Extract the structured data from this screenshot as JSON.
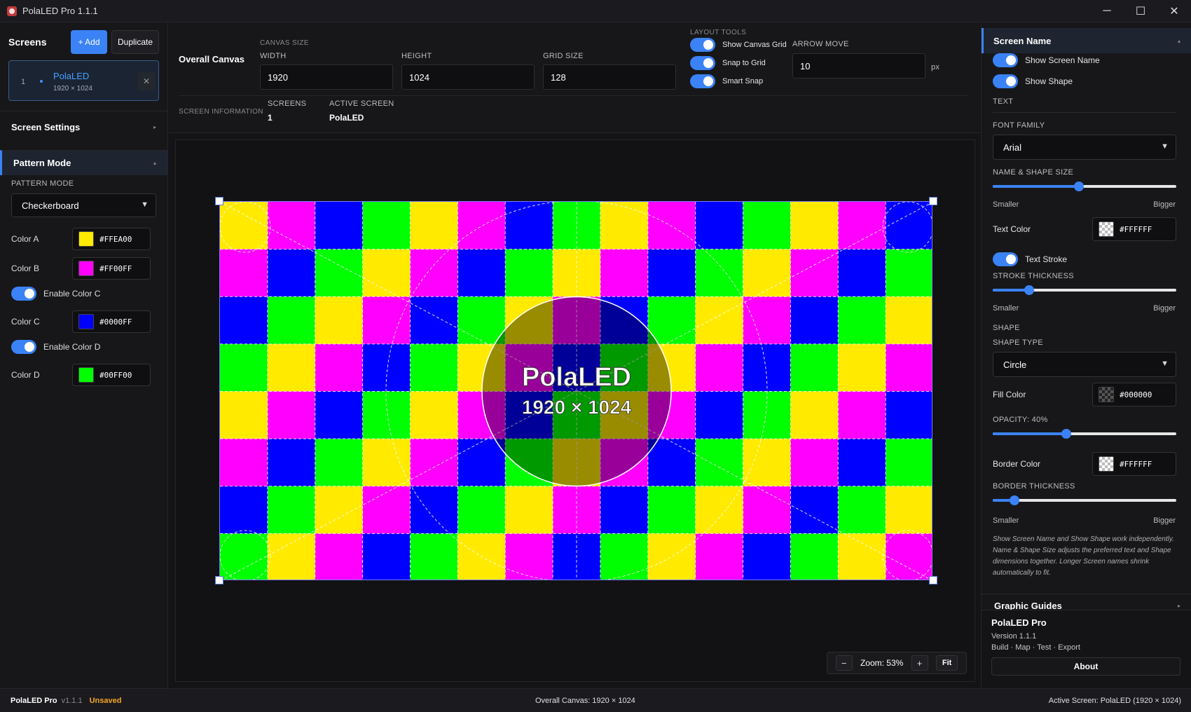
{
  "window": {
    "title": "PolaLED Pro 1.1.1",
    "minimize": "─",
    "maximize": "☐",
    "close": "✕"
  },
  "screens": {
    "title": "Screens",
    "add_label": "+ Add",
    "duplicate_label": "Duplicate",
    "items": [
      {
        "index": "1",
        "name": "PolaLED",
        "size": "1920 × 1024"
      }
    ]
  },
  "screen_settings": {
    "label": "Screen Settings"
  },
  "pattern_mode": {
    "label": "Pattern Mode",
    "sub_label": "PATTERN MODE",
    "selected": "Checkerboard",
    "colors": [
      {
        "label": "Color A",
        "hex": "#FFEA00",
        "swatch": "#FFEA00"
      },
      {
        "label": "Color B",
        "hex": "#FF00FF",
        "swatch": "#FF00FF"
      },
      {
        "label": "Color C",
        "hex": "#0000FF",
        "swatch": "#0000FF"
      },
      {
        "label": "Color D",
        "hex": "#00FF00",
        "swatch": "#00FF00"
      }
    ],
    "enable_c": "Enable Color C",
    "enable_d": "Enable Color D"
  },
  "toolbar": {
    "overall_canvas": "Overall Canvas",
    "canvas_size": "CANVAS SIZE",
    "width_label": "WIDTH",
    "width_value": "1920",
    "height_label": "HEIGHT",
    "height_value": "1024",
    "grid_label": "GRID SIZE",
    "grid_value": "128",
    "layout_tools": "LAYOUT TOOLS",
    "show_grid": "Show Canvas Grid",
    "snap_grid": "Snap to Grid",
    "smart_snap": "Smart Snap",
    "arrow_move_label": "ARROW MOVE",
    "arrow_move_value": "10",
    "arrow_unit": "px",
    "screen_information": "SCREEN INFORMATION",
    "screens_label": "SCREENS",
    "screens_value": "1",
    "active_label": "ACTIVE SCREEN",
    "active_value": "PolaLED"
  },
  "canvas": {
    "screen_name": "PolaLED",
    "screen_size": "1920 × 1024",
    "zoom_label": "Zoom: 53%",
    "zoom_out": "−",
    "zoom_in": "+",
    "fit": "Fit",
    "pattern_rows": [
      "YMBGYMBGYMBGYMB",
      "MBGYMBGYMBGYMBG",
      "BGYMBGYMBGYMBGY",
      "GYMBGYMBGYMBGYM",
      "YMBGYMBGYMBGYMB",
      "MBGYMBGYMBGYMBG",
      "BGYMBGYMBGYMBGY",
      "GYMBGYMBGYMBGYM"
    ]
  },
  "screen_name_panel": {
    "label": "Screen Name",
    "show_name": "Show Screen Name",
    "show_shape": "Show Shape",
    "text_section": "TEXT",
    "font_family_label": "FONT FAMILY",
    "font_family_value": "Arial",
    "name_shape_size": "NAME & SHAPE SIZE",
    "name_shape_level": 0.47,
    "smaller": "Smaller",
    "bigger": "Bigger",
    "text_color_label": "Text Color",
    "text_color_hex": "#FFFFFF",
    "text_stroke": "Text Stroke",
    "stroke_thickness": "STROKE THICKNESS",
    "stroke_level": 0.2,
    "shape_section": "SHAPE",
    "shape_type_label": "SHAPE TYPE",
    "shape_type_value": "Circle",
    "fill_color_label": "Fill Color",
    "fill_color_hex": "#000000",
    "opacity_label": "OPACITY: 40%",
    "opacity_level": 0.4,
    "border_color_label": "Border Color",
    "border_color_hex": "#FFFFFF",
    "border_thickness": "BORDER THICKNESS",
    "border_level": 0.12,
    "note": "Show Screen Name and Show Shape work independently. Name & Shape Size adjusts the preferred text and Shape dimensions together. Longer Screen names shrink automatically to fit."
  },
  "graphic_guides": {
    "label": "Graphic Guides"
  },
  "about": {
    "title": "PolaLED Pro",
    "version": "Version 1.1.1",
    "tagline": "Build · Map · Test · Export",
    "button": "About"
  },
  "status": {
    "brand": "PolaLED Pro",
    "version": "v1.1.1",
    "unsaved": "Unsaved",
    "center": "Overall Canvas: 1920 × 1024",
    "right": "Active Screen: PolaLED (1920 × 1024)"
  },
  "colors": {
    "accent": "#3b82f6",
    "Y": "#FFEA00",
    "M": "#FF00FF",
    "B": "#0000FF",
    "G": "#00FF00"
  }
}
